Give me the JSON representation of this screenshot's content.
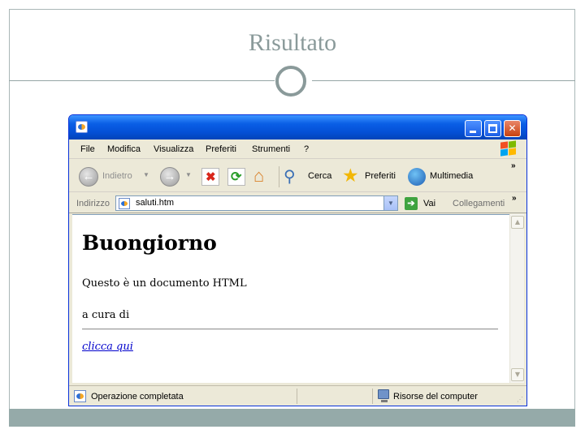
{
  "slide": {
    "title": "Risultato"
  },
  "browser": {
    "menu": [
      "File",
      "Modifica",
      "Visualizza",
      "Preferiti",
      "Strumenti",
      "?"
    ],
    "toolbar": {
      "back_label": "Indietro",
      "search_label": "Cerca",
      "favorites_label": "Preferiti",
      "media_label": "Multimedia",
      "chevron": "»"
    },
    "address": {
      "label": "Indirizzo",
      "value": "saluti.htm",
      "go_label": "Vai",
      "links_label": "Collegamenti",
      "chevron": "»"
    },
    "page": {
      "heading": "Buongiorno",
      "paragraph": "Questo è un documento HTML",
      "author_line": "a cura di",
      "link_text": "clicca qui"
    },
    "status": {
      "text": "Operazione completata",
      "zone": "Risorse del computer"
    }
  },
  "colors": {
    "title_gray": "#8a9a9a",
    "footer_bar": "#95aaa9",
    "xp_blue": "#0450d6",
    "xp_chrome": "#ece9d8",
    "link_blue": "#0000cc"
  },
  "icons": [
    "ie-page-icon",
    "minimize-icon",
    "maximize-icon",
    "close-icon",
    "windows-flag-icon",
    "back-arrow-icon",
    "forward-arrow-icon",
    "stop-icon",
    "refresh-icon",
    "home-icon",
    "search-magnifier-icon",
    "favorites-star-icon",
    "media-globe-icon",
    "go-arrow-icon",
    "computer-icon"
  ]
}
